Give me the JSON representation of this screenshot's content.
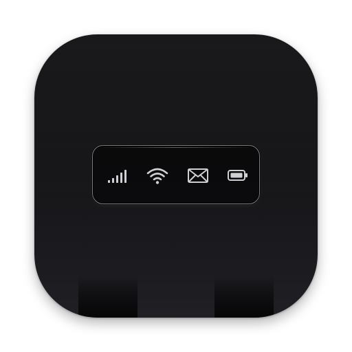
{
  "icon": {
    "name": "mobile-hotspot-app-icon",
    "background_top": "#111113",
    "background_bottom": "#1f1f24",
    "panel_border": "#7c7c82",
    "glyph_color": "#d0d0d4"
  },
  "status_panel": {
    "indicators": [
      {
        "id": "signal",
        "icon": "signal-strength-icon"
      },
      {
        "id": "wifi",
        "icon": "wifi-icon"
      },
      {
        "id": "mail",
        "icon": "envelope-icon"
      },
      {
        "id": "battery",
        "icon": "battery-icon"
      }
    ]
  }
}
